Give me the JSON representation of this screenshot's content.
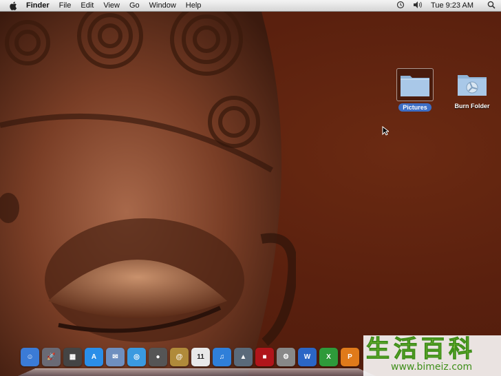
{
  "menubar": {
    "app_name": "Finder",
    "menus": [
      "File",
      "Edit",
      "View",
      "Go",
      "Window",
      "Help"
    ],
    "clock": "Tue 9:23 AM",
    "icons": [
      "apple-icon",
      "time-machine-icon",
      "volume-icon",
      "spotlight-icon"
    ]
  },
  "desktop": {
    "icons": [
      {
        "label": "Pictures",
        "icon": "folder-icon",
        "selected": true
      },
      {
        "label": "Burn Folder",
        "icon": "burn-folder-icon",
        "selected": false
      }
    ]
  },
  "dock": {
    "apps": [
      {
        "name": "finder",
        "glyph": "☺",
        "color": "#3b7bd6"
      },
      {
        "name": "launchpad",
        "glyph": "🚀",
        "color": "#6a6a75"
      },
      {
        "name": "mission-control",
        "glyph": "▦",
        "color": "#444"
      },
      {
        "name": "app-store",
        "glyph": "A",
        "color": "#2a8ee8"
      },
      {
        "name": "mail",
        "glyph": "✉",
        "color": "#6f8fbf"
      },
      {
        "name": "safari",
        "glyph": "◎",
        "color": "#3a9ae0"
      },
      {
        "name": "facetime",
        "glyph": "●",
        "color": "#555"
      },
      {
        "name": "address-book",
        "glyph": "@",
        "color": "#b08a3a"
      },
      {
        "name": "calendar",
        "glyph": "11",
        "color": "#e8e8e8"
      },
      {
        "name": "itunes",
        "glyph": "♫",
        "color": "#2f7fd9"
      },
      {
        "name": "iphoto",
        "glyph": "▲",
        "color": "#5a6a7a"
      },
      {
        "name": "photo-booth",
        "glyph": "■",
        "color": "#b0151a"
      },
      {
        "name": "system-preferences",
        "glyph": "⚙",
        "color": "#888"
      },
      {
        "name": "word",
        "glyph": "W",
        "color": "#2b66c6"
      },
      {
        "name": "excel",
        "glyph": "X",
        "color": "#2e9a3a"
      },
      {
        "name": "powerpoint",
        "glyph": "P",
        "color": "#e07a1a"
      }
    ]
  },
  "watermark": {
    "chinese": "生活百科",
    "url": "www.bimeiz.com"
  },
  "colors": {
    "menubar": "#e6e6e6",
    "selection": "#3d6ec5",
    "wallpaper": "#5a200e"
  }
}
